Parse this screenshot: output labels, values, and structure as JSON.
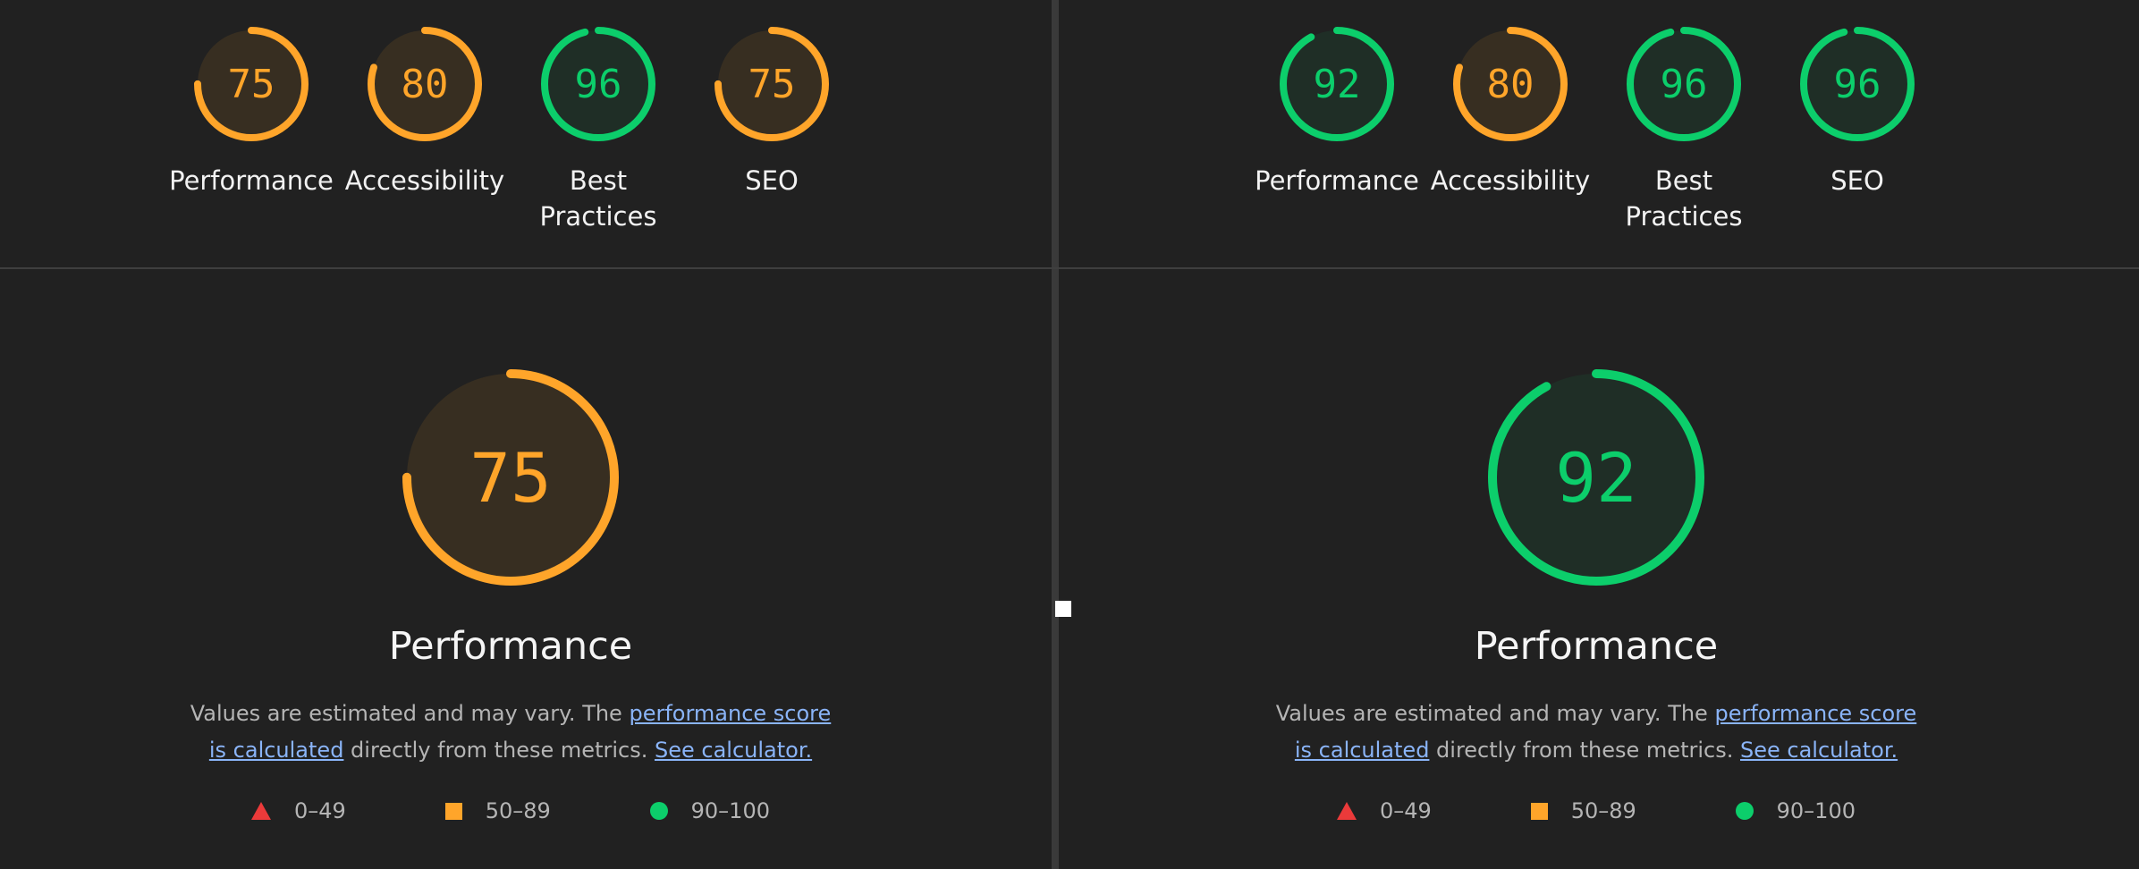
{
  "colors": {
    "average": "#ffa52a",
    "pass": "#0cce6b",
    "fail": "#eb3a3a",
    "link": "#8ab4f8"
  },
  "left": {
    "summary": [
      {
        "label": "Performance",
        "score": "75",
        "value": 75,
        "rating": "average"
      },
      {
        "label": "Accessibility",
        "score": "80",
        "value": 80,
        "rating": "average"
      },
      {
        "label": "Best Practices",
        "score": "96",
        "value": 96,
        "rating": "pass"
      },
      {
        "label": "SEO",
        "score": "75",
        "value": 75,
        "rating": "average"
      }
    ],
    "detail": {
      "score": "75",
      "value": 75,
      "rating": "average",
      "title": "Performance",
      "desc_prefix": "Values are estimated and may vary. The ",
      "desc_link1": "performance score is calculated",
      "desc_middle": " directly from these metrics. ",
      "desc_link2": "See calculator."
    },
    "legend": {
      "fail": "0–49",
      "average": "50–89",
      "pass": "90–100"
    }
  },
  "right": {
    "summary": [
      {
        "label": "Performance",
        "score": "92",
        "value": 92,
        "rating": "pass"
      },
      {
        "label": "Accessibility",
        "score": "80",
        "value": 80,
        "rating": "average"
      },
      {
        "label": "Best Practices",
        "score": "96",
        "value": 96,
        "rating": "pass"
      },
      {
        "label": "SEO",
        "score": "96",
        "value": 96,
        "rating": "pass"
      }
    ],
    "detail": {
      "score": "92",
      "value": 92,
      "rating": "pass",
      "title": "Performance",
      "desc_prefix": "Values are estimated and may vary. The ",
      "desc_link1": "performance score is calculated",
      "desc_middle": " directly from these metrics. ",
      "desc_link2": "See calculator."
    },
    "legend": {
      "fail": "0–49",
      "average": "50–89",
      "pass": "90–100"
    }
  }
}
